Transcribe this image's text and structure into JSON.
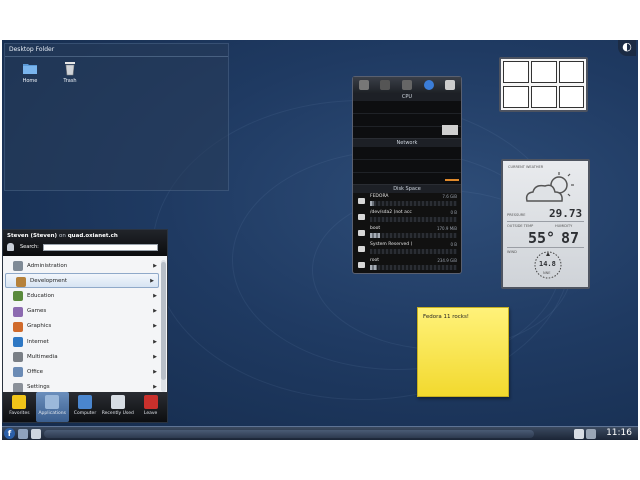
{
  "desktop_folder": {
    "title": "Desktop Folder",
    "icons": [
      {
        "label": "Home",
        "icon": "home-folder-icon"
      },
      {
        "label": "Trash",
        "icon": "trash-icon"
      }
    ]
  },
  "system_monitor": {
    "sections": [
      "CPU",
      "Network",
      "Disk Space"
    ],
    "disks": [
      {
        "name": "FEDORA",
        "size": "7.6 GiB",
        "used_fraction": 0.05
      },
      {
        "name": "/dev/sda2 (not acc",
        "size": "0 B",
        "used_fraction": 0.0
      },
      {
        "name": "boot",
        "size": "170.9 MiB",
        "used_fraction": 0.12
      },
      {
        "name": "System Reserved (",
        "size": "0 B",
        "used_fraction": 0.0
      },
      {
        "name": "root",
        "size": "234.9 GiB",
        "used_fraction": 0.08
      }
    ]
  },
  "weather": {
    "header": "CURRENT WEATHER",
    "pressure_label": "PRESSURE",
    "pressure": "29.73",
    "temp_label": "OUTSIDE TEMP",
    "temp": "55°",
    "humidity_label": "HUMIDITY",
    "humidity": "87",
    "wind_label": "WIND",
    "wind": "14.8",
    "wind_dir": "NNE"
  },
  "note": {
    "text": "Fedora 11 rocks!"
  },
  "kickoff": {
    "user": "Steven (Steven)",
    "on": "on",
    "host": "quad.oxianet.ch",
    "search_label": "Search:",
    "search_value": "",
    "categories": [
      {
        "label": "Administration",
        "icon": "administration-icon",
        "color": "#7f8a96"
      },
      {
        "label": "Development",
        "icon": "development-icon",
        "color": "#b5813a"
      },
      {
        "label": "Education",
        "icon": "education-icon",
        "color": "#5a8a3c"
      },
      {
        "label": "Games",
        "icon": "games-icon",
        "color": "#8c6ab0"
      },
      {
        "label": "Graphics",
        "icon": "graphics-icon",
        "color": "#d06a2b"
      },
      {
        "label": "Internet",
        "icon": "internet-icon",
        "color": "#2f78c4"
      },
      {
        "label": "Multimedia",
        "icon": "multimedia-icon",
        "color": "#7a7f86"
      },
      {
        "label": "Office",
        "icon": "office-icon",
        "color": "#6b8bb5"
      },
      {
        "label": "Settings",
        "icon": "settings-icon",
        "color": "#8a9099"
      }
    ],
    "selected_index": 1,
    "tabs": [
      {
        "label": "Favorites",
        "icon": "star-icon",
        "color": "#f0c419"
      },
      {
        "label": "Applications",
        "icon": "applications-icon",
        "color": "#9bb8da"
      },
      {
        "label": "Computer",
        "icon": "computer-icon",
        "color": "#4a86cf"
      },
      {
        "label": "Recently Used",
        "icon": "clock-icon",
        "color": "#d7dde4"
      },
      {
        "label": "Leave",
        "icon": "power-icon",
        "color": "#c9302c"
      }
    ]
  },
  "taskbar": {
    "clock": "11:16"
  }
}
